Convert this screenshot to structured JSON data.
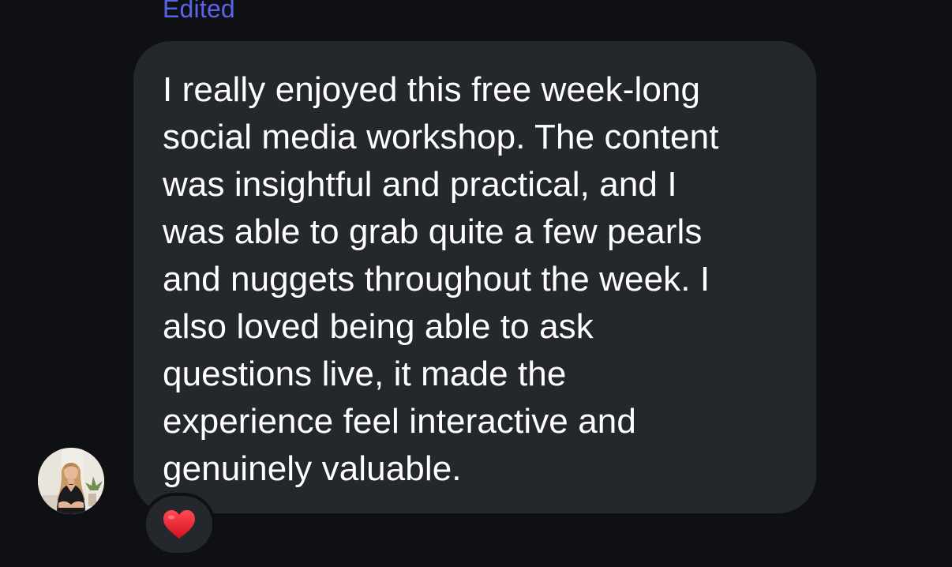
{
  "message": {
    "status_label": "Edited",
    "lines": [
      "I really enjoyed this free week-long",
      "social media workshop. The content",
      "was insightful and practical, and I",
      "was able to grab quite a few pearls",
      "and nuggets throughout the week. I",
      "also loved being able to ask",
      "questions live, it made the",
      "experience feel interactive and",
      "genuinely valuable."
    ],
    "reaction": {
      "icon": "red-heart-icon",
      "color": "#e8192c"
    }
  },
  "avatar": {
    "icon": "user-avatar-photo"
  },
  "colors": {
    "background": "#0f1014",
    "bubble": "#24272c",
    "accent": "#5b63e8",
    "text": "#ffffff"
  }
}
